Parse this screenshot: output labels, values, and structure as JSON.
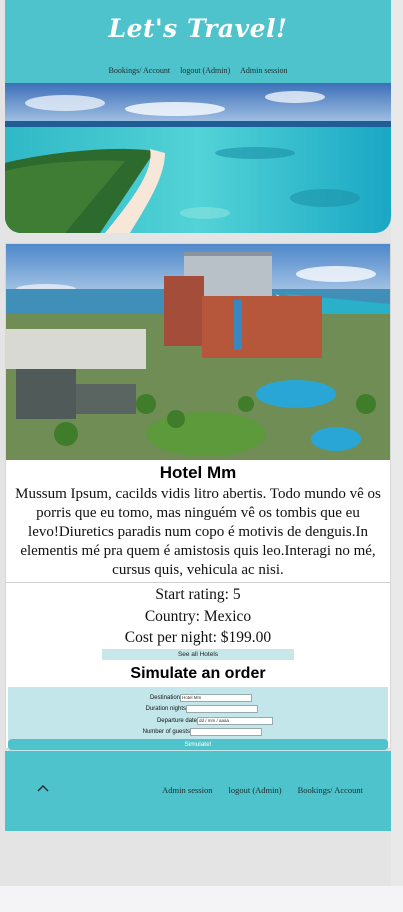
{
  "header": {
    "brand": "Let's Travel!",
    "nav": [
      "Bookings/ Account",
      "logout (Admin)",
      "Admin session"
    ]
  },
  "hotel": {
    "name": "Hotel Mm",
    "description": "Mussum Ipsum, cacilds vidis litro abertis. Todo mundo vê os porris que eu tomo, mas ninguém vê os tombis que eu levo!Diuretics paradis num copo é motivis de denguis.In elementis mé pra quem é amistosis quis leo.Interagi no mé, cursus quis, vehicula ac nisi.",
    "rating": "Start rating: 5",
    "country": "Country: Mexico",
    "cost": "Cost per night: $199.00",
    "see_all": "See all Hotels"
  },
  "simulate": {
    "title": "Simulate an order",
    "destination_label": "Destination",
    "destination_value": "Hotel Mm",
    "duration_label": "Duration nights",
    "duration_value": "",
    "departure_label": "Departure date",
    "departure_value": "dd / mm / aaaa",
    "guests_label": "Number of guests",
    "guests_value": "",
    "button": "Simulate!"
  },
  "footer": {
    "nav": [
      "Admin session",
      "logout (Admin)",
      "Bookings/ Account"
    ]
  },
  "colors": {
    "accent": "#4fc3cb",
    "light_accent": "#c3e6ea"
  },
  "icons": {
    "back_to_top": "chevron-up-icon"
  }
}
